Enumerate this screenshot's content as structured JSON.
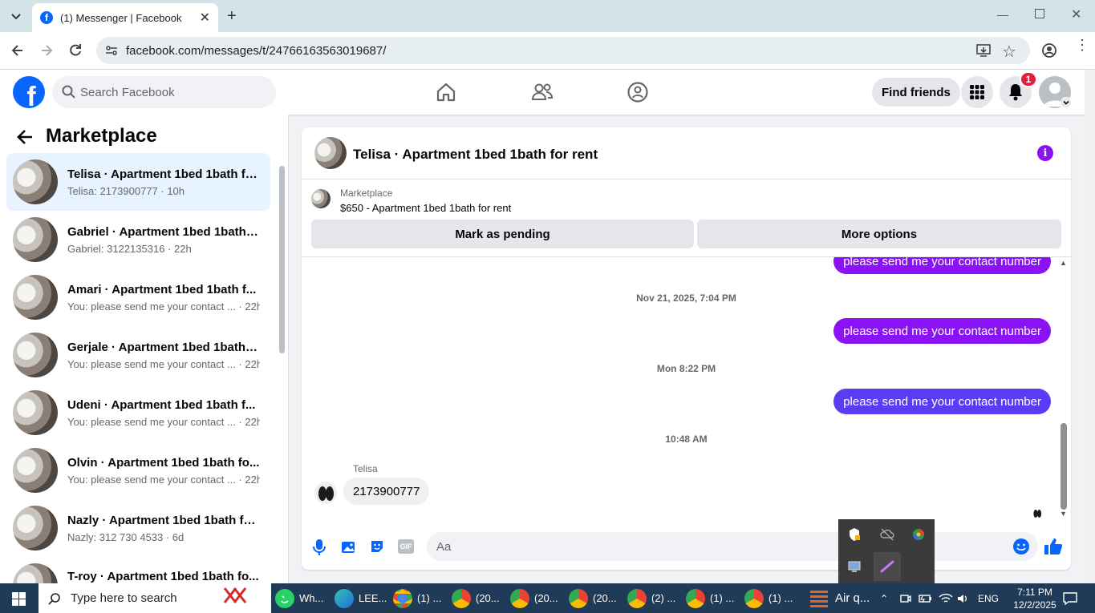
{
  "browser": {
    "tab_title": "(1) Messenger | Facebook",
    "url": "facebook.com/messages/t/24766163563019687/"
  },
  "header": {
    "search_placeholder": "Search Facebook",
    "find_friends": "Find friends",
    "notification_count": "1"
  },
  "sidebar": {
    "title": "Marketplace",
    "conversations": [
      {
        "name": "Telisa · Apartment 1bed 1bath fo...",
        "sub": "Telisa: 2173900777 · 10h"
      },
      {
        "name": "Gabriel · Apartment 1bed 1bath f...",
        "sub": "Gabriel: 3122135316 · 22h"
      },
      {
        "name": "Amari · Apartment 1bed 1bath f...",
        "sub": "You: please send me your contact ... · 22h"
      },
      {
        "name": "Gerjale · Apartment 1bed 1bath f...",
        "sub": "You: please send me your contact ... · 22h"
      },
      {
        "name": "Udeni · Apartment 1bed 1bath f...",
        "sub": "You: please send me your contact ... · 22h"
      },
      {
        "name": "Olvin · Apartment 1bed 1bath fo...",
        "sub": "You: please send me your contact ... · 22h"
      },
      {
        "name": "Nazly · Apartment 1bed 1bath fo...",
        "sub": "Nazly: 312 730 4533 · 6d"
      },
      {
        "name": "T-roy · Apartment 1bed 1bath fo...",
        "sub": ""
      }
    ]
  },
  "chat": {
    "title": "Telisa · Apartment 1bed 1bath for rent",
    "listing_source": "Marketplace",
    "listing_title": "$650 - Apartment 1bed 1bath for rent",
    "mark_pending": "Mark as pending",
    "more_options": "More options",
    "messages": {
      "m0": "please send me your contact number",
      "t1": "Nov 21, 2025, 7:04 PM",
      "m1": "please send me your contact number",
      "t2": "Mon 8:22 PM",
      "m2": "please send me your contact number",
      "t3": "10:48 AM",
      "sender": "Telisa",
      "reply": "2173900777"
    },
    "composer_placeholder": "Aa",
    "gif_label": "GIF"
  },
  "taskbar": {
    "search": "Type here to search",
    "items": [
      "Wh...",
      "LEE...",
      "(1) ...",
      "(20...",
      "(20...",
      "(20...",
      "(2) ...",
      "(1) ...",
      "(1) ..."
    ],
    "weather": "Air q...",
    "lang": "ENG",
    "time": "7:11 PM",
    "date": "12/2/2025"
  },
  "colors": {
    "fb_blue": "#0866ff",
    "bubble_purple": "#8a12f5",
    "bubble_indigo": "#5b3cf5"
  }
}
